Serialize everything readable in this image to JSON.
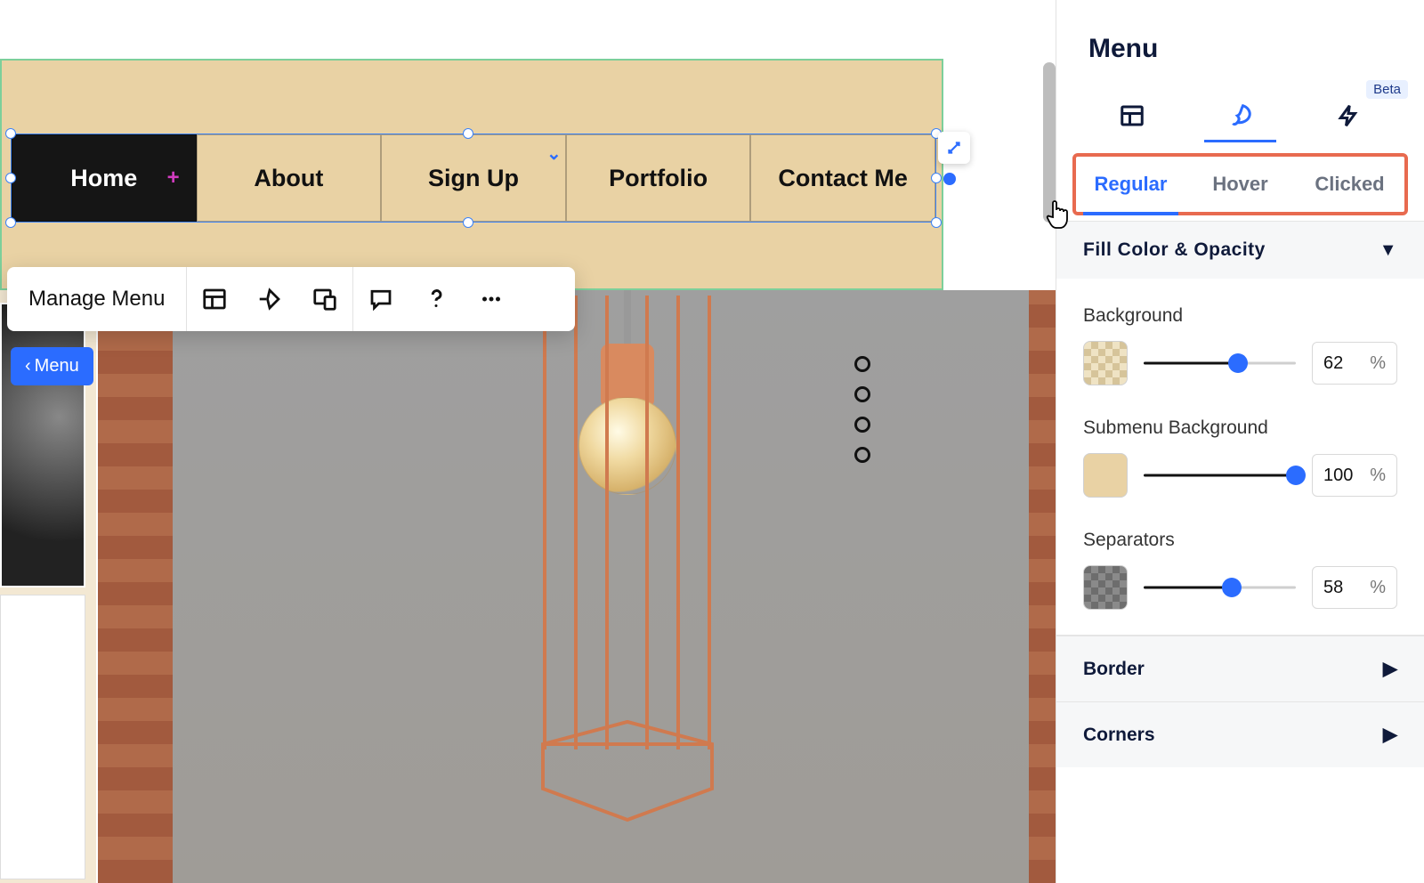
{
  "panel": {
    "title": "Menu",
    "beta_label": "Beta",
    "state_tabs": {
      "regular": "Regular",
      "hover": "Hover",
      "clicked": "Clicked"
    },
    "sections": {
      "fill": {
        "title": "Fill Color & Opacity",
        "background_label": "Background",
        "submenu_label": "Submenu Background",
        "separators_label": "Separators",
        "bg_value": "62",
        "submenu_value": "100",
        "sep_value": "58",
        "pct": "%"
      },
      "border": {
        "title": "Border"
      },
      "corners": {
        "title": "Corners"
      }
    }
  },
  "nav": {
    "items": [
      "Home",
      "About",
      "Sign Up",
      "Portfolio",
      "Contact Me"
    ]
  },
  "toolbar": {
    "manage_label": "Manage Menu"
  },
  "chip": {
    "label": "Menu"
  }
}
